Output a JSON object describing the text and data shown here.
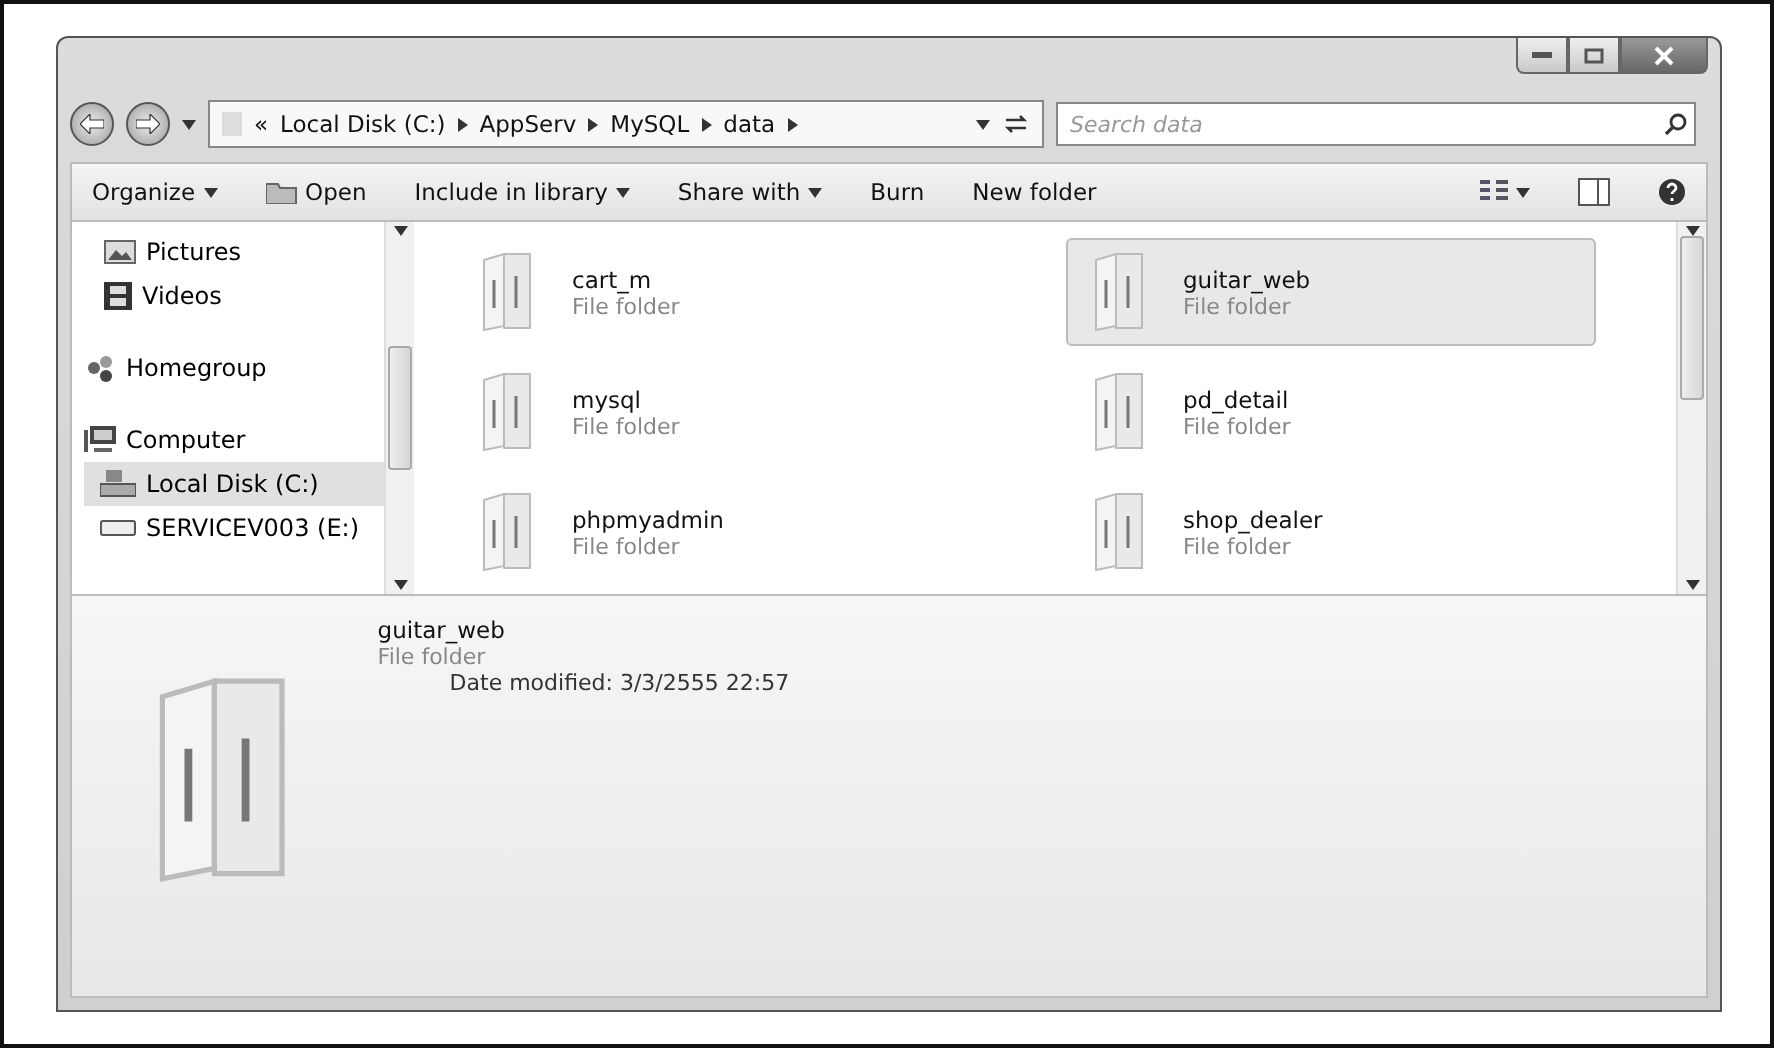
{
  "address_bar": {
    "overflow": "«",
    "crumbs": [
      "Local Disk (C:)",
      "AppServ",
      "MySQL",
      "data"
    ]
  },
  "search": {
    "placeholder": "Search data"
  },
  "toolbar": {
    "items": [
      {
        "label": "Organize",
        "dropdown": true,
        "icon": false
      },
      {
        "label": "Open",
        "dropdown": false,
        "icon": true
      },
      {
        "label": "Include in library",
        "dropdown": true,
        "icon": false
      },
      {
        "label": "Share with",
        "dropdown": true,
        "icon": false
      },
      {
        "label": "Burn",
        "dropdown": false,
        "icon": false
      },
      {
        "label": "New folder",
        "dropdown": false,
        "icon": false
      }
    ]
  },
  "sidebar": {
    "items": [
      {
        "label": "Pictures",
        "kind": "pictures",
        "group_start": false,
        "selected": false,
        "indent": false
      },
      {
        "label": "Videos",
        "kind": "videos",
        "group_start": false,
        "selected": false,
        "indent": false
      },
      {
        "label": "Homegroup",
        "kind": "homegroup",
        "group_start": true,
        "selected": false,
        "indent": false
      },
      {
        "label": "Computer",
        "kind": "computer",
        "group_start": true,
        "selected": false,
        "indent": false
      },
      {
        "label": "Local Disk (C:)",
        "kind": "disk",
        "group_start": false,
        "selected": true,
        "indent": true
      },
      {
        "label": "SERVICEV003 (E:)",
        "kind": "drive",
        "group_start": false,
        "selected": false,
        "indent": true
      }
    ]
  },
  "files": [
    {
      "name": "cart_m",
      "type": "File folder",
      "selected": false
    },
    {
      "name": "guitar_web",
      "type": "File folder",
      "selected": true
    },
    {
      "name": "mysql",
      "type": "File folder",
      "selected": false
    },
    {
      "name": "pd_detail",
      "type": "File folder",
      "selected": false
    },
    {
      "name": "phpmyadmin",
      "type": "File folder",
      "selected": false
    },
    {
      "name": "shop_dealer",
      "type": "File folder",
      "selected": false
    }
  ],
  "details": {
    "name": "guitar_web",
    "type": "File folder",
    "date_label": "Date modified:",
    "date": "3/3/2555 22:57"
  }
}
